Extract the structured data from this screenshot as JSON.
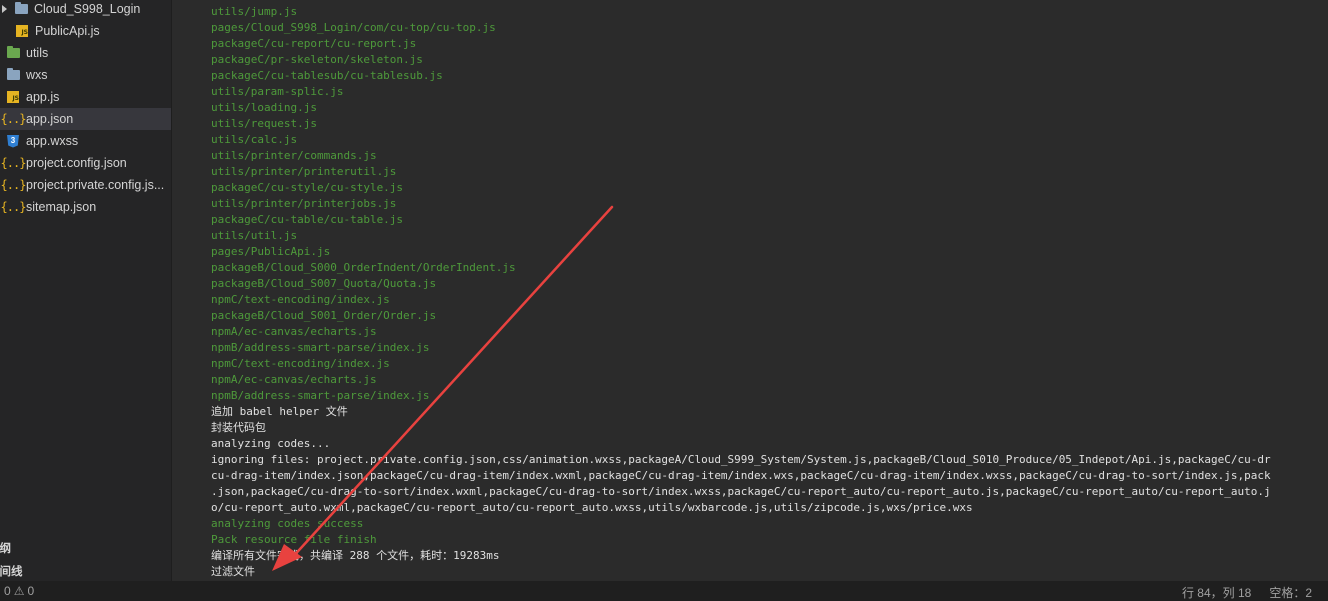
{
  "sidebar": {
    "items": [
      {
        "label": "Cloud_S998_Login",
        "icon": "folder-icon",
        "chevron": true
      },
      {
        "label": "PublicApi.js",
        "icon": "js-file-icon"
      },
      {
        "label": "utils",
        "icon": "folder-green-icon"
      },
      {
        "label": "wxs",
        "icon": "folder-icon"
      },
      {
        "label": "app.js",
        "icon": "js-file-icon"
      },
      {
        "label": "app.json",
        "icon": "json-file-icon",
        "selected": true
      },
      {
        "label": "app.wxss",
        "icon": "css-file-icon"
      },
      {
        "label": "project.config.json",
        "icon": "json-file-icon"
      },
      {
        "label": "project.private.config.js...",
        "icon": "json-file-icon"
      },
      {
        "label": "sitemap.json",
        "icon": "json-file-icon"
      }
    ],
    "outline_label": "大纲",
    "timeline_label": "时间线"
  },
  "console": {
    "lines": [
      {
        "text": "utils/jump.js",
        "color": "green"
      },
      {
        "text": "pages/Cloud_S998_Login/com/cu-top/cu-top.js",
        "color": "green"
      },
      {
        "text": "packageC/cu-report/cu-report.js",
        "color": "green"
      },
      {
        "text": "packageC/pr-skeleton/skeleton.js",
        "color": "green"
      },
      {
        "text": "packageC/cu-tablesub/cu-tablesub.js",
        "color": "green"
      },
      {
        "text": "utils/param-splic.js",
        "color": "green"
      },
      {
        "text": "utils/loading.js",
        "color": "green"
      },
      {
        "text": "utils/request.js",
        "color": "green"
      },
      {
        "text": "utils/calc.js",
        "color": "green"
      },
      {
        "text": "utils/printer/commands.js",
        "color": "green"
      },
      {
        "text": "utils/printer/printerutil.js",
        "color": "green"
      },
      {
        "text": "packageC/cu-style/cu-style.js",
        "color": "green"
      },
      {
        "text": "utils/printer/printerjobs.js",
        "color": "green"
      },
      {
        "text": "packageC/cu-table/cu-table.js",
        "color": "green"
      },
      {
        "text": "utils/util.js",
        "color": "green"
      },
      {
        "text": "pages/PublicApi.js",
        "color": "green"
      },
      {
        "text": "packageB/Cloud_S000_OrderIndent/OrderIndent.js",
        "color": "green"
      },
      {
        "text": "packageB/Cloud_S007_Quota/Quota.js",
        "color": "green"
      },
      {
        "text": "npmC/text-encoding/index.js",
        "color": "green"
      },
      {
        "text": "packageB/Cloud_S001_Order/Order.js",
        "color": "green"
      },
      {
        "text": "npmA/ec-canvas/echarts.js",
        "color": "green"
      },
      {
        "text": "npmB/address-smart-parse/index.js",
        "color": "green"
      },
      {
        "text": "npmC/text-encoding/index.js",
        "color": "green"
      },
      {
        "text": "npmA/ec-canvas/echarts.js",
        "color": "green"
      },
      {
        "text": "npmB/address-smart-parse/index.js",
        "color": "green"
      },
      {
        "text": "追加 babel helper 文件",
        "color": "white"
      },
      {
        "text": "封装代码包",
        "color": "white"
      },
      {
        "text": "analyzing codes...",
        "color": "white"
      },
      {
        "text": "ignoring files: project.private.config.json,css/animation.wxss,packageA/Cloud_S999_System/System.js,packageB/Cloud_S010_Produce/05_Indepot/Api.js,packageC/cu-dr",
        "color": "white"
      },
      {
        "text": "cu-drag-item/index.json,packageC/cu-drag-item/index.wxml,packageC/cu-drag-item/index.wxs,packageC/cu-drag-item/index.wxss,packageC/cu-drag-to-sort/index.js,pack",
        "color": "white"
      },
      {
        "text": ".json,packageC/cu-drag-to-sort/index.wxml,packageC/cu-drag-to-sort/index.wxss,packageC/cu-report_auto/cu-report_auto.js,packageC/cu-report_auto/cu-report_auto.j",
        "color": "white"
      },
      {
        "text": "o/cu-report_auto.wxml,packageC/cu-report_auto/cu-report_auto.wxss,utils/wxbarcode.js,utils/zipcode.js,wxs/price.wxs",
        "color": "white"
      },
      {
        "text": "analyzing codes success",
        "color": "green"
      },
      {
        "text": "Pack resource file finish",
        "color": "green"
      },
      {
        "text": "编译所有文件完成，共编译 288 个文件，耗时：19283ms",
        "color": "white"
      },
      {
        "text": "过滤文件",
        "color": "white"
      }
    ]
  },
  "statusbar": {
    "errors": "0",
    "warnings": "0",
    "position": "行 84，列 18",
    "indent": "空格：2"
  },
  "colors": {
    "console_green": "#4e9a3b",
    "annotation_arrow": "#e8423f"
  }
}
